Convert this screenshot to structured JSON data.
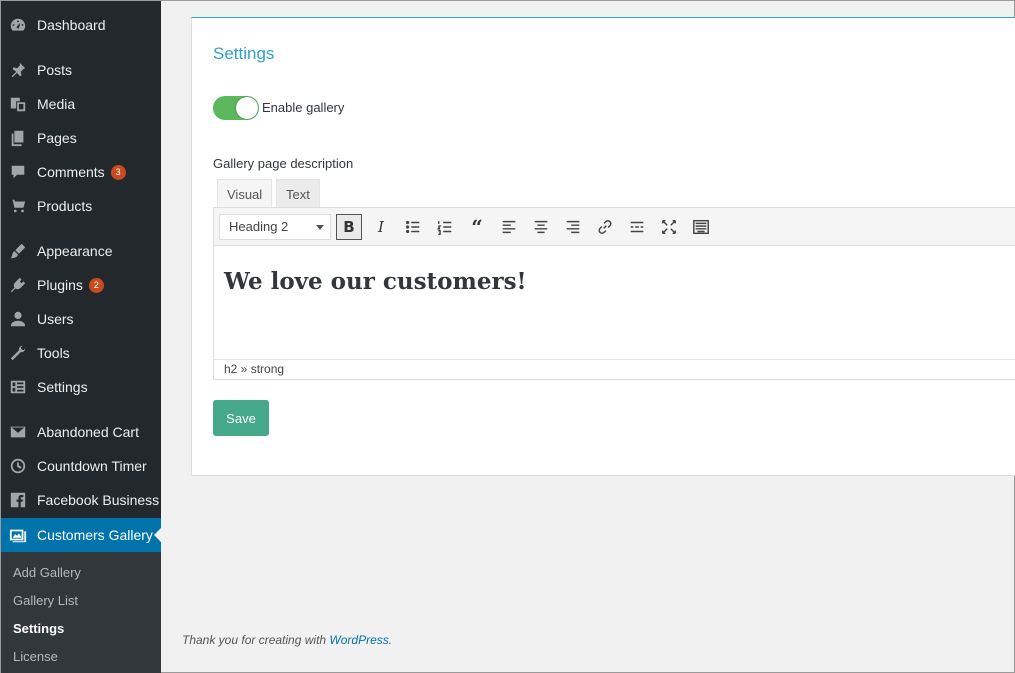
{
  "sidebar": {
    "items": [
      {
        "label": "Dashboard",
        "icon": "dashboard-icon"
      },
      {
        "label": "Posts",
        "icon": "pin-icon"
      },
      {
        "label": "Media",
        "icon": "media-icon"
      },
      {
        "label": "Pages",
        "icon": "pages-icon"
      },
      {
        "label": "Comments",
        "icon": "comment-icon",
        "badge": "3"
      },
      {
        "label": "Products",
        "icon": "cart-icon"
      },
      {
        "label": "Appearance",
        "icon": "brush-icon"
      },
      {
        "label": "Plugins",
        "icon": "plugin-icon",
        "badge": "2"
      },
      {
        "label": "Users",
        "icon": "user-icon"
      },
      {
        "label": "Tools",
        "icon": "wrench-icon"
      },
      {
        "label": "Settings",
        "icon": "settings-icon"
      },
      {
        "label": "Abandoned Cart",
        "icon": "mail-icon"
      },
      {
        "label": "Countdown Timer",
        "icon": "clock-icon"
      },
      {
        "label": "Facebook Business",
        "icon": "facebook-icon"
      },
      {
        "label": "Customers Gallery",
        "icon": "gallery-icon"
      }
    ],
    "submenu": [
      "Add Gallery",
      "Gallery List",
      "Settings",
      "License"
    ]
  },
  "panel": {
    "title": "Settings",
    "toggle": {
      "label": "Enable gallery",
      "enabled": true
    },
    "description_label": "Gallery page description",
    "editor": {
      "tabs": [
        "Visual",
        "Text"
      ],
      "format_select": "Heading 2",
      "content": "We love our customers!",
      "status_path": "h2 » strong"
    },
    "save_label": "Save"
  },
  "footer": {
    "text": "Thank you for creating with ",
    "link": "WordPress",
    "suffix": "."
  },
  "colors": {
    "sidebar_bg": "#23282d",
    "sidebar_active": "#0073aa",
    "title_accent": "#2ea2cc",
    "toggle_on": "#5cb85c",
    "save_button": "#45a889",
    "badge": "#ca4a1f"
  }
}
